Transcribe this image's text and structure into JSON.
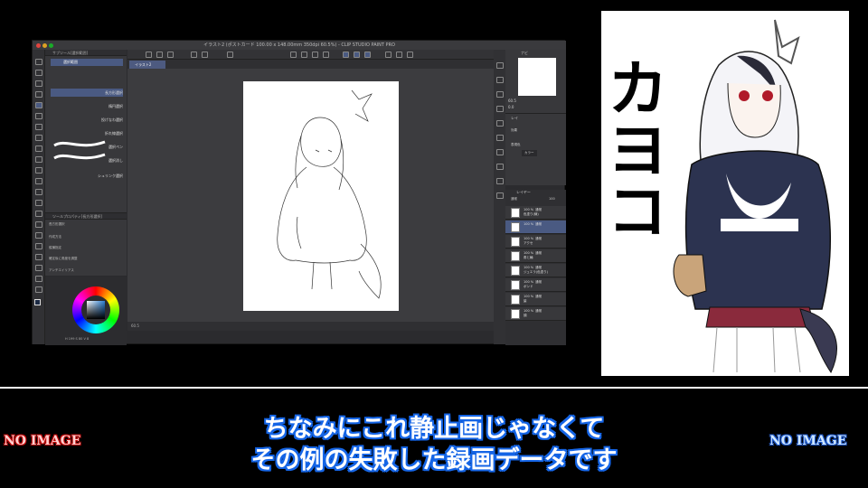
{
  "app": {
    "window_title": "イラスト2 (ポストカード 100.00 x 148.00mm 350dpi 60.5%) - CLIP STUDIO PAINT PRO",
    "canvas_tab": "イラスト2",
    "zoom": "60.5",
    "subtool_panel": {
      "header": "サブツール[選択範囲]",
      "group": "選択範囲",
      "items": [
        "長方形選択",
        "楕円選択",
        "投げなわ選択",
        "折れ線選択",
        "選択ペン",
        "選択消し",
        "シュリンク選択"
      ]
    },
    "tool_property": {
      "header": "ツールプロパティ[長方形選択]",
      "title": "長方形選択",
      "rows": [
        "作成方法",
        "縦横指定",
        "確定後に角度を調整",
        "アンチエイリアス"
      ]
    },
    "color_values": "H 199  S 80  V 8",
    "navigator_tab": "ナビ",
    "navigator_values": [
      "60.5",
      "0.0"
    ],
    "layer_property": {
      "tab": "レイ",
      "label1": "効果",
      "label2": "表現色",
      "value2": "カラー"
    },
    "layer_panel": {
      "tab": "レイヤー",
      "blend": "通常",
      "opacity": "100",
      "layers": [
        {
          "opacity": "100 %",
          "mode": "通常",
          "name": "色塗り(線)"
        },
        {
          "opacity": "100 %",
          "mode": "通常",
          "name": ""
        },
        {
          "opacity": "100 %",
          "mode": "通常",
          "name": "アクセ"
        },
        {
          "opacity": "100 %",
          "mode": "通常",
          "name": "角と輪"
        },
        {
          "opacity": "100 %",
          "mode": "通常",
          "name": "ジュエラ(色塗り)"
        },
        {
          "opacity": "100 %",
          "mode": "通常",
          "name": "ボンド"
        },
        {
          "opacity": "100 %",
          "mode": "通常",
          "name": "髪"
        },
        {
          "opacity": "100 %",
          "mode": "通常",
          "name": "顔"
        }
      ]
    }
  },
  "preview": {
    "big_text": "カヨコ"
  },
  "subtitles": {
    "line1": "ちなみにこれ静止画じゃなくて",
    "line2": "その例の失敗した録画データです"
  },
  "no_image_left": "NO IMAGE",
  "no_image_right": "NO IMAGE",
  "colors": {
    "subtitle_outline": "#1565e6",
    "no_image_left_outline": "#bb0000",
    "no_image_right_outline": "#1a55c9",
    "selection": "#4a5a82"
  }
}
